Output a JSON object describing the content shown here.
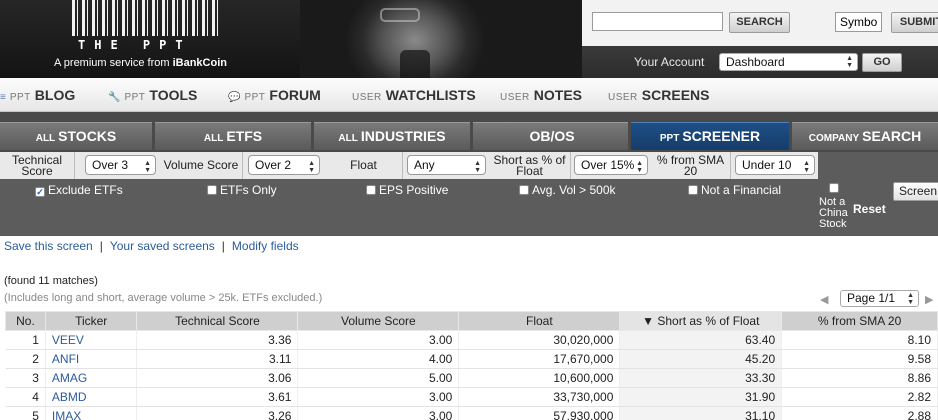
{
  "header": {
    "brand_word": "THE PPT",
    "tagline_prefix": "A premium service from",
    "tagline_brand": "iBankCoin",
    "search": {
      "value": "",
      "button": "SEARCH"
    },
    "symbol": {
      "value": "Symbol",
      "button": "SUBMIT"
    },
    "account_label": "Your Account",
    "account_select": "Dashboard",
    "go_button": "GO"
  },
  "nav": [
    {
      "prefix": "PPT",
      "label": "BLOG",
      "icon": "blog-icon"
    },
    {
      "prefix": "PPT",
      "label": "TOOLS",
      "icon": "wrench-icon"
    },
    {
      "prefix": "PPT",
      "label": "FORUM",
      "icon": "chat-icon"
    },
    {
      "prefix": "USER",
      "label": "WATCHLISTS"
    },
    {
      "prefix": "USER",
      "label": "NOTES"
    },
    {
      "prefix": "USER",
      "label": "SCREENS"
    }
  ],
  "tabs": [
    {
      "prefix": "ALL",
      "label": "STOCKS"
    },
    {
      "prefix": "ALL",
      "label": "ETFS"
    },
    {
      "prefix": "ALL",
      "label": "INDUSTRIES"
    },
    {
      "prefix": "",
      "label": "OB/OS"
    },
    {
      "prefix": "PPT",
      "label": "SCREENER",
      "active": true
    },
    {
      "prefix": "COMPANY",
      "label": "SEARCH"
    }
  ],
  "filters": {
    "technical_score": {
      "label": "Technical Score",
      "value": "Over 3"
    },
    "volume_score": {
      "label": "Volume Score",
      "value": "Over 2"
    },
    "float": {
      "label": "Float",
      "value": "Any"
    },
    "short_float": {
      "label": "Short as % of Float",
      "value": "Over 15%"
    },
    "sma20": {
      "label": "% from SMA 20",
      "value": "Under 10"
    },
    "checkboxes": [
      {
        "label": "Exclude ETFs",
        "checked": true
      },
      {
        "label": "ETFs Only",
        "checked": false
      },
      {
        "label": "EPS Positive",
        "checked": false
      },
      {
        "label": "Avg. Vol > 500k",
        "checked": false
      },
      {
        "label": "Not a Financial",
        "checked": false
      }
    ],
    "not_china": "Not a China Stock",
    "reset": "Reset",
    "screen_button": "Screen"
  },
  "links": {
    "save": "Save this screen",
    "saved": "Your saved screens",
    "modify": "Modify fields",
    "separator": "|"
  },
  "found": "(found 11 matches)",
  "includes_note": "(Includes long and short, average volume > 25k. ETFs excluded.)",
  "pager": {
    "value": "Page 1/1"
  },
  "table": {
    "columns": [
      "No.",
      "Ticker",
      "Technical Score",
      "Volume Score",
      "Float",
      "Short as % of Float",
      "% from SMA 20"
    ],
    "sorted_column": "Short as % of Float",
    "rows": [
      [
        "1",
        "VEEV",
        "3.36",
        "3.00",
        "30,020,000",
        "63.40",
        "8.10"
      ],
      [
        "2",
        "ANFI",
        "3.11",
        "4.00",
        "17,670,000",
        "45.20",
        "9.58"
      ],
      [
        "3",
        "AMAG",
        "3.06",
        "5.00",
        "10,600,000",
        "33.30",
        "8.86"
      ],
      [
        "4",
        "ABMD",
        "3.61",
        "3.00",
        "33,730,000",
        "31.90",
        "2.82"
      ],
      [
        "5",
        "IMAX",
        "3.26",
        "3.00",
        "57,930,000",
        "31.10",
        "2.88"
      ]
    ]
  }
}
